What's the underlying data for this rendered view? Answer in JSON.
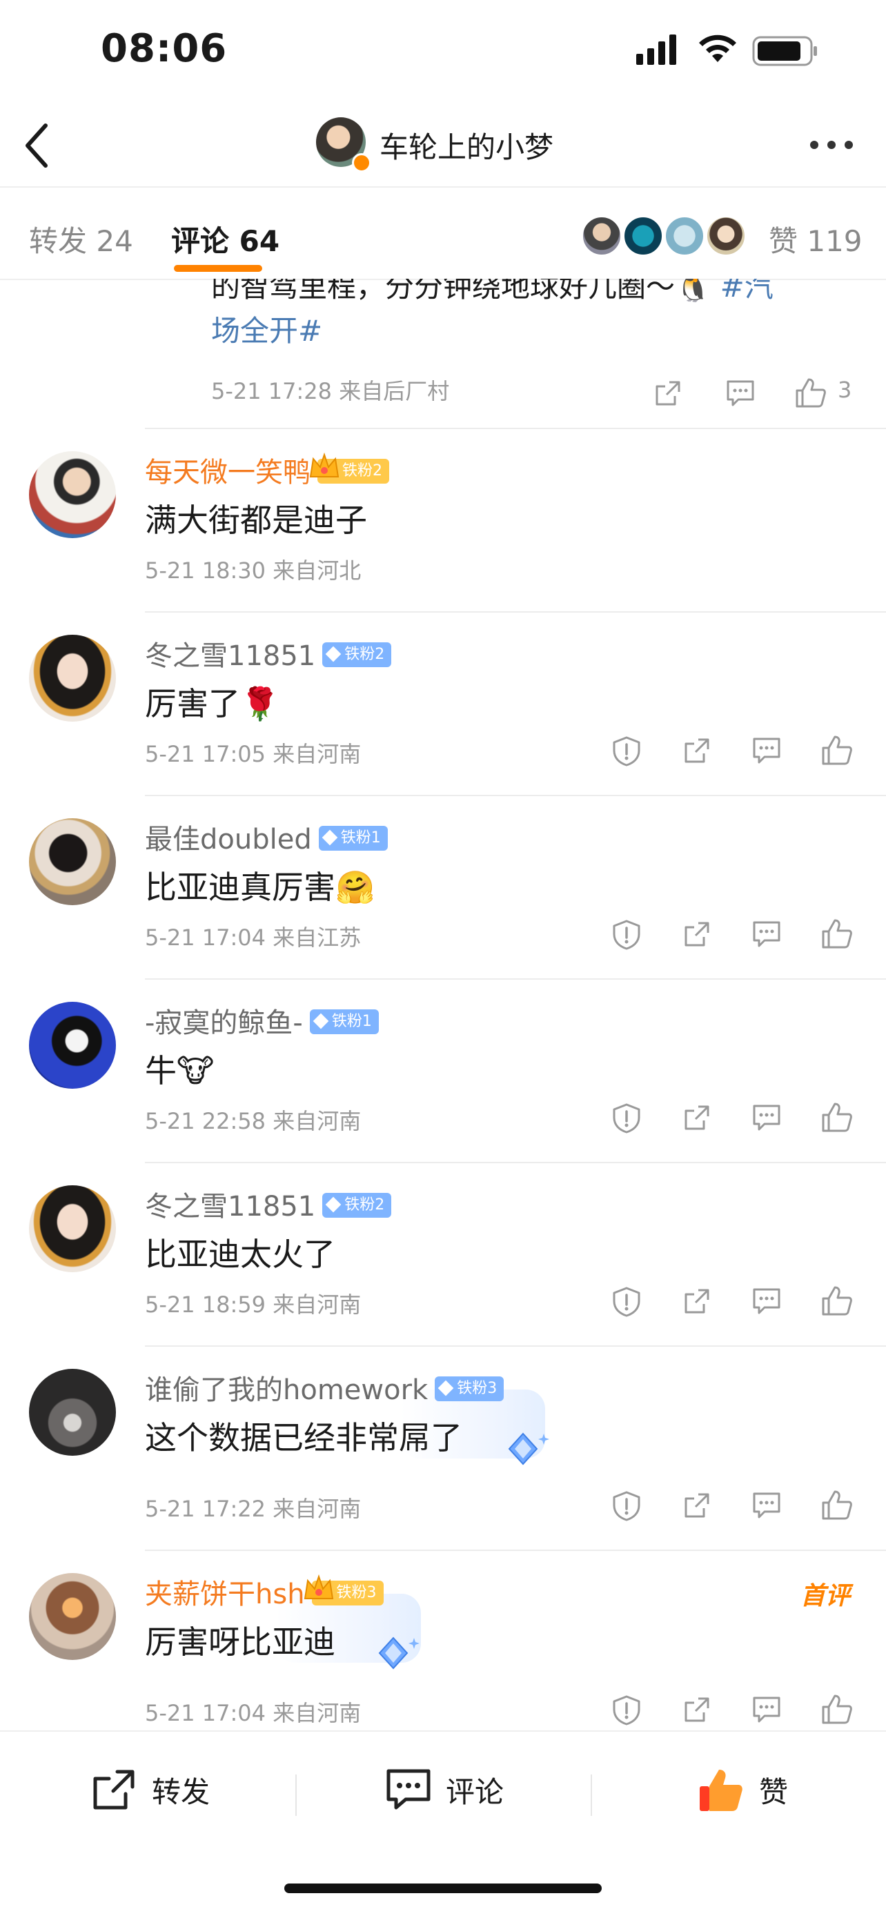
{
  "status_bar": {
    "time": "08:06"
  },
  "nav": {
    "title": "车轮上的小梦"
  },
  "tabs": {
    "repost": "转发 24",
    "comment": "评论 64",
    "likes": "赞 119"
  },
  "partial_comment": {
    "line1": "的智驾里程，分分钟绕地球好几圈～🐧 ",
    "hashtag_start": "#汽",
    "hashtag_end": "场全开#",
    "meta": "5-21 17:28  来自后厂村",
    "like_count": "3"
  },
  "comments": [
    {
      "username": "每天微一笑鸭",
      "badge": "铁粉2",
      "text": "满大街都是迪子",
      "meta": "5-21 18:30  来自河北"
    },
    {
      "username": "冬之雪11851",
      "badge": "铁粉2",
      "text": "厉害了🌹",
      "meta": "5-21 17:05  来自河南"
    },
    {
      "username": "最佳doubled",
      "badge": "铁粉1",
      "text": "比亚迪真厉害🤗",
      "meta": "5-21 17:04  来自江苏"
    },
    {
      "username": "-寂寞的鲸鱼-",
      "badge": "铁粉1",
      "text": "牛🐮",
      "meta": "5-21 22:58  来自河南"
    },
    {
      "username": "冬之雪11851",
      "badge": "铁粉2",
      "text": "比亚迪太火了",
      "meta": "5-21 18:59  来自河南"
    },
    {
      "username": "谁偷了我的homework",
      "badge": "铁粉3",
      "text": "这个数据已经非常屌了",
      "meta": "5-21 17:22  来自河南"
    },
    {
      "username": "夹薪饼干hsh",
      "badge": "铁粉3",
      "text": "厉害呀比亚迪",
      "meta": "5-21 17:04  来自河南",
      "tag": "首评"
    }
  ],
  "bottom_bar": {
    "repost": "转发",
    "comment": "评论",
    "like": "赞"
  },
  "colors": {
    "accent": "#ff8200",
    "username_vip": "#f47b20",
    "hashtag": "#4a7bb3",
    "badge_blue": "#7fb4ff"
  },
  "icons": [
    "signal-icon",
    "wifi-icon",
    "battery-icon",
    "back-icon",
    "more-icon",
    "report-icon",
    "share-icon",
    "comment-icon",
    "like-icon"
  ]
}
